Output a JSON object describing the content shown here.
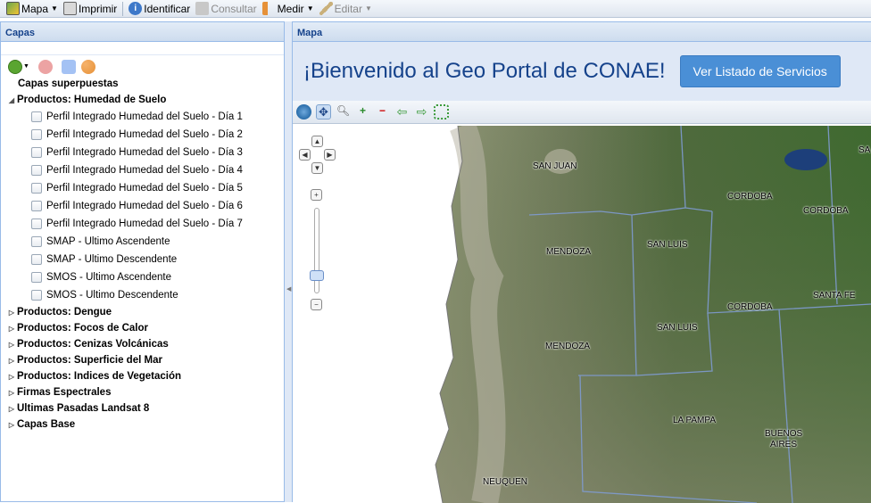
{
  "toolbar": {
    "mapa": "Mapa",
    "imprimir": "Imprimir",
    "identificar": "Identificar",
    "consultar": "Consultar",
    "medir": "Medir",
    "editar": "Editar"
  },
  "layers_panel": {
    "title": "Capas",
    "overlays": "Capas superpuestas",
    "humedad_group": "Productos: Humedad de Suelo",
    "humedad_items": [
      "Perfil Integrado Humedad del Suelo - Día 1",
      "Perfil Integrado Humedad del Suelo - Día 2",
      "Perfil Integrado Humedad del Suelo - Día 3",
      "Perfil Integrado Humedad del Suelo - Día 4",
      "Perfil Integrado Humedad del Suelo - Día 5",
      "Perfil Integrado Humedad del Suelo - Día 6",
      "Perfil Integrado Humedad del Suelo - Día 7",
      "SMAP - Ultimo Ascendente",
      "SMAP - Ultimo Descendente",
      "SMOS - Ultimo Ascendente",
      "SMOS - Ultimo Descendente"
    ],
    "groups": [
      "Productos: Dengue",
      "Productos: Focos de Calor",
      "Productos: Cenizas Volcánicas",
      "Productos: Superficie del Mar",
      "Productos: Indices de Vegetación",
      "Firmas Espectrales",
      "Ultimas Pasadas Landsat 8",
      "Capas Base"
    ]
  },
  "map_panel": {
    "title": "Mapa",
    "welcome": "¡Bienvenido al Geo Portal de CONAE!",
    "services_button": "Ver Listado de Servicios"
  },
  "map_labels": {
    "san_juan": "SAN JUAN",
    "cordoba_1": "CORDOBA",
    "cordoba_2": "CORDOBA",
    "cordoba_3": "CORDOBA",
    "san_luis_1": "SAN LUIS",
    "san_luis_2": "SAN LUIS",
    "mendoza_1": "MENDOZA",
    "mendoza_2": "MENDOZA",
    "santa_fe": "SANTA FE",
    "la_pampa": "LA PAMPA",
    "buenos_aires_1": "BUENOS",
    "buenos_aires_2": "AIRES",
    "neuquen": "NEUQUEN",
    "s_edge": "SA"
  },
  "colors": {
    "header_text": "#15428b",
    "button_bg": "#4a8fd6",
    "panel_border": "#99bbe8"
  }
}
